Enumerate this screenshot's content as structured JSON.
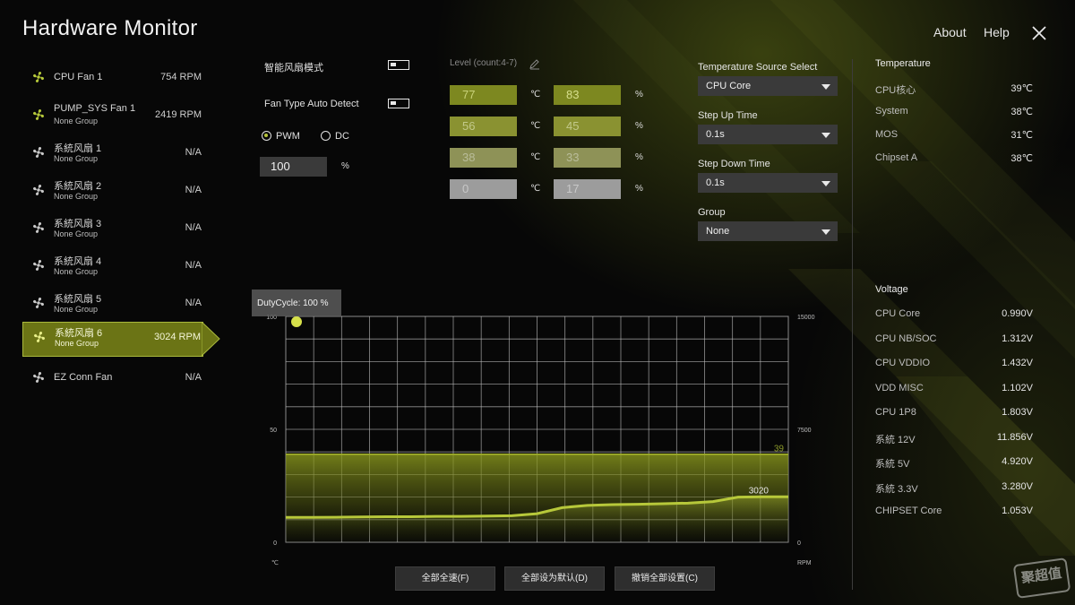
{
  "app": {
    "title": "Hardware Monitor"
  },
  "topnav": {
    "about": "About",
    "help": "Help"
  },
  "fans": [
    {
      "name": "CPU Fan 1",
      "group": "",
      "rpm": "754 RPM",
      "active": false
    },
    {
      "name": "PUMP_SYS Fan 1",
      "group": "None Group",
      "rpm": "2419 RPM",
      "active": false
    },
    {
      "name": "系統风扇 1",
      "group": "None Group",
      "rpm": "N/A",
      "active": false
    },
    {
      "name": "系統风扇 2",
      "group": "None Group",
      "rpm": "N/A",
      "active": false
    },
    {
      "name": "系統风扇 3",
      "group": "None Group",
      "rpm": "N/A",
      "active": false
    },
    {
      "name": "系統风扇 4",
      "group": "None Group",
      "rpm": "N/A",
      "active": false
    },
    {
      "name": "系統风扇 5",
      "group": "None Group",
      "rpm": "N/A",
      "active": false
    },
    {
      "name": "系統风扇 6",
      "group": "None Group",
      "rpm": "3024 RPM",
      "active": true
    },
    {
      "name": "EZ Conn Fan",
      "group": "",
      "rpm": "N/A",
      "active": false
    }
  ],
  "controls": {
    "smart_fan_label": "智能风扇模式",
    "fan_type_label": "Fan Type Auto Detect",
    "pwm_label": "PWM",
    "dc_label": "DC",
    "mode_selected": "PWM",
    "duty_value": "100",
    "duty_unit": "%"
  },
  "levels": {
    "header": "Level (count:4-7)",
    "temp_unit": "℃",
    "pct_unit": "%",
    "rows": [
      {
        "temp": "77",
        "pct": "83"
      },
      {
        "temp": "56",
        "pct": "45"
      },
      {
        "temp": "38",
        "pct": "33"
      },
      {
        "temp": "0",
        "pct": "17"
      }
    ]
  },
  "settings": {
    "temp_source_label": "Temperature Source Select",
    "temp_source_value": "CPU Core",
    "step_up_label": "Step Up Time",
    "step_up_value": "0.1s",
    "step_down_label": "Step Down Time",
    "step_down_value": "0.1s",
    "group_label": "Group",
    "group_value": "None"
  },
  "temperature": {
    "header": "Temperature",
    "items": [
      {
        "name": "CPU核心",
        "value": "39℃"
      },
      {
        "name": "System",
        "value": "38℃"
      },
      {
        "name": "MOS",
        "value": "31℃"
      },
      {
        "name": "Chipset A",
        "value": "38℃"
      }
    ]
  },
  "voltage": {
    "header": "Voltage",
    "items": [
      {
        "name": "CPU Core",
        "value": "0.990V"
      },
      {
        "name": "CPU NB/SOC",
        "value": "1.312V"
      },
      {
        "name": "CPU VDDIO",
        "value": "1.432V"
      },
      {
        "name": "VDD MISC",
        "value": "1.102V"
      },
      {
        "name": "CPU 1P8",
        "value": "1.803V"
      },
      {
        "name": "系統 12V",
        "value": "11.856V"
      },
      {
        "name": "系統 5V",
        "value": "4.920V"
      },
      {
        "name": "系統 3.3V",
        "value": "3.280V"
      },
      {
        "name": "CHIPSET Core",
        "value": "1.053V"
      }
    ]
  },
  "chart_data": {
    "type": "line",
    "tooltip": "DutyCycle: 100 %",
    "left_axis": {
      "ticks": [
        "100",
        "50",
        "0"
      ],
      "unit": "℃",
      "ylim": [
        0,
        100
      ]
    },
    "right_axis": {
      "ticks": [
        "15000",
        "7500",
        "0"
      ],
      "unit": "RPM",
      "ylim": [
        0,
        15000
      ]
    },
    "series": [
      {
        "values": [
          39,
          39,
          39,
          39,
          39,
          39,
          39,
          39,
          39,
          39,
          39,
          39,
          39,
          39,
          39,
          39,
          39,
          39,
          39,
          39,
          39
        ]
      },
      {
        "values": [
          1650,
          1650,
          1660,
          1680,
          1700,
          1700,
          1720,
          1720,
          1740,
          1760,
          1900,
          2300,
          2450,
          2500,
          2520,
          2560,
          2600,
          2700,
          3000,
          3020,
          3020
        ]
      }
    ],
    "temp_current_label": "39",
    "rpm_current_label": "3020",
    "control_point": {
      "x": 0,
      "y": 100
    }
  },
  "buttons": {
    "full_speed": "全部全速(F)",
    "default_all": "全部设为默认(D)",
    "undo_all": "撤销全部设置(C)"
  },
  "watermark": "聚超值"
}
